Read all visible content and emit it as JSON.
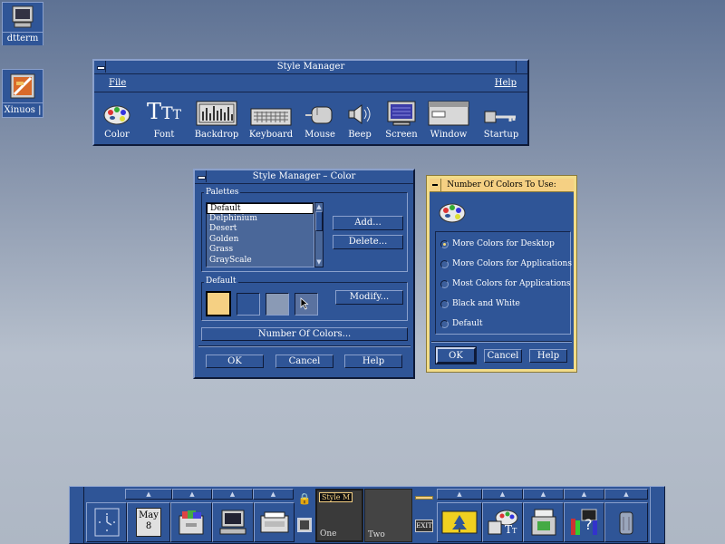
{
  "desktop": {
    "icons": [
      {
        "label": "dtterm"
      },
      {
        "label": "Xinuos |"
      }
    ]
  },
  "style_manager": {
    "title": "Style Manager",
    "menu": {
      "file": "File",
      "help": "Help"
    },
    "items": [
      {
        "label": "Color",
        "icon": "palette-icon"
      },
      {
        "label": "Font",
        "icon": "font-icon"
      },
      {
        "label": "Backdrop",
        "icon": "backdrop-icon"
      },
      {
        "label": "Keyboard",
        "icon": "keyboard-icon"
      },
      {
        "label": "Mouse",
        "icon": "mouse-icon"
      },
      {
        "label": "Beep",
        "icon": "speaker-icon"
      },
      {
        "label": "Screen",
        "icon": "monitor-icon"
      },
      {
        "label": "Window",
        "icon": "window-icon"
      },
      {
        "label": "Startup",
        "icon": "key-icon"
      }
    ]
  },
  "color_dialog": {
    "title": "Style Manager – Color",
    "palettes_label": "Palettes",
    "palettes": [
      "Default",
      "Delphinium",
      "Desert",
      "Golden",
      "Grass",
      "GrayScale"
    ],
    "selected_palette": "Default",
    "add_button": "Add...",
    "delete_button": "Delete...",
    "palette_group_label": "Default",
    "modify_button": "Modify...",
    "swatch_colors": [
      "#f5d083",
      "#2f5597",
      "#8a9ab5",
      "#5a72a0"
    ],
    "number_of_colors_button": "Number Of Colors...",
    "ok": "OK",
    "cancel": "Cancel",
    "help": "Help"
  },
  "num_colors_dialog": {
    "title": "Number Of Colors To Use:",
    "options": [
      "More Colors for Desktop",
      "More Colors for Applications",
      "Most Colors for Applications",
      "Black and White",
      "Default"
    ],
    "selected_index": 0,
    "ok": "OK",
    "cancel": "Cancel",
    "help": "Help"
  },
  "front_panel": {
    "calendar_month": "May",
    "calendar_day": "8",
    "workspaces": [
      "One",
      "Two"
    ],
    "workspace_tooltip": "Style M",
    "exit_label": "EXIT"
  },
  "colors": {
    "panel_blue": "#2f5597",
    "accent_yellow": "#f5d083",
    "selection_white": "#ffffff"
  }
}
